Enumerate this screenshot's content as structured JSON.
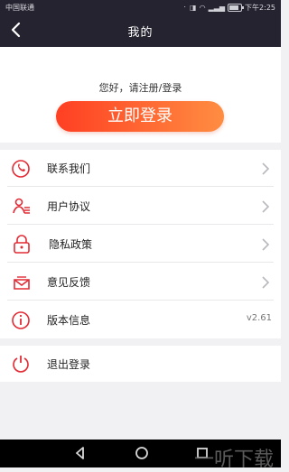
{
  "status": {
    "carrier": "中国联通",
    "time": "下午2:25"
  },
  "header": {
    "title": "我的"
  },
  "hero": {
    "greeting": "您好，请注册/登录",
    "login_button": "立即登录"
  },
  "menu": {
    "items": [
      {
        "label": "联系我们",
        "icon": "phone-icon"
      },
      {
        "label": "用户协议",
        "icon": "user-agreement-icon"
      },
      {
        "label": "隐私政策",
        "icon": "lock-icon"
      },
      {
        "label": "意见反馈",
        "icon": "mail-icon"
      },
      {
        "label": "版本信息",
        "icon": "info-icon",
        "value": "v2.61"
      }
    ]
  },
  "logout": {
    "label": "退出登录"
  },
  "watermark": "一听下载"
}
